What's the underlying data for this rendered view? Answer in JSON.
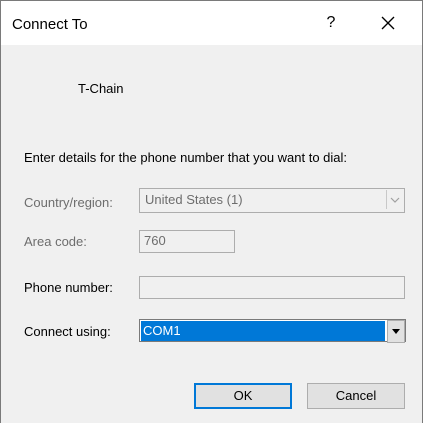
{
  "window": {
    "title": "Connect To",
    "help_label": "?"
  },
  "connection": {
    "name": "T-Chain"
  },
  "instructions": "Enter details for the phone number that you want to dial:",
  "country": {
    "label": "Country/region:",
    "value": "United States (1)"
  },
  "area_code": {
    "label": "Area code:",
    "value": "760"
  },
  "phone": {
    "label": "Phone number:",
    "value": ""
  },
  "connect_using": {
    "label": "Connect using:",
    "value": "COM1"
  },
  "buttons": {
    "ok": "OK",
    "cancel": "Cancel"
  },
  "colors": {
    "selection": "#0078d7",
    "disabled_text": "#6d6d6d"
  }
}
